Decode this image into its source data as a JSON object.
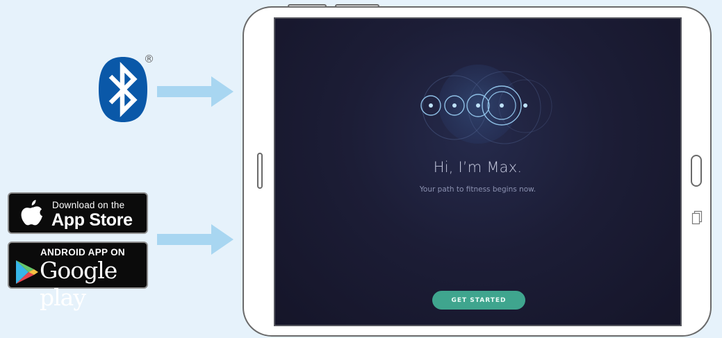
{
  "bluetooth": {
    "registered_mark": "®",
    "icon": "bluetooth-icon",
    "brand_color": "#0a58a8"
  },
  "arrows": {
    "color": "#a8d6f1"
  },
  "app_store": {
    "line1": "Download on the",
    "line2": "App Store",
    "icon": "apple-icon"
  },
  "google_play": {
    "line1": "ANDROID APP ON",
    "line2": "Google play",
    "icon": "play-icon"
  },
  "tablet_screen": {
    "greeting": "Hi, I’m Max.",
    "subtitle": "Your path to fitness begins now.",
    "cta_label": "GET STARTED",
    "cta_color": "#3fa58e",
    "background_color": "#1c1d36"
  }
}
